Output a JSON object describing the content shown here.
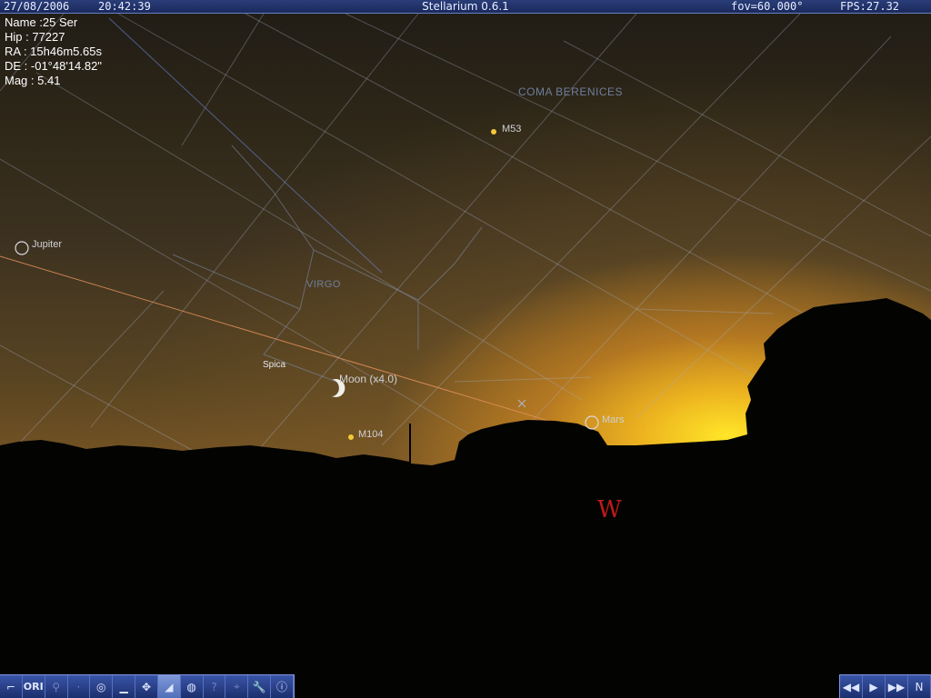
{
  "topbar": {
    "date": "27/08/2006",
    "time": "20:42:39",
    "title": "Stellarium 0.6.1",
    "fov": "fov=60.000°",
    "fps": "FPS:27.32"
  },
  "info": {
    "name": "Name :25 Ser",
    "hip": "Hip : 77227",
    "ra": "RA : 15h46m5.65s",
    "de": "DE : -01°48'14.82\"",
    "mag": "Mag : 5.41"
  },
  "sky_labels": {
    "jupiter": "Jupiter",
    "m53": "M53",
    "coma": "COMA BERENICES",
    "virgo": "VIRGO",
    "spica": "Spica",
    "moon": "Moon (x4.0)",
    "m104": "M104",
    "mars": "Mars",
    "west": "W"
  },
  "toolbar_left": [
    {
      "id": "constellation-lines",
      "icon": "constellation-icon",
      "label": "⌐",
      "state": "normal"
    },
    {
      "id": "constellation-names",
      "icon": "ori-icon",
      "label": "ORI",
      "state": "normal"
    },
    {
      "id": "constellation-art",
      "icon": "art-icon",
      "label": "⚲",
      "state": "dim"
    },
    {
      "id": "azimuth-grid",
      "icon": "dot-icon",
      "label": "·",
      "state": "dim"
    },
    {
      "id": "equatorial-grid",
      "icon": "grid-icon",
      "label": "◎",
      "state": "normal"
    },
    {
      "id": "ground",
      "icon": "ground-icon",
      "label": "▁",
      "state": "normal"
    },
    {
      "id": "cardinal-points",
      "icon": "cardinal-icon",
      "label": "✥",
      "state": "normal"
    },
    {
      "id": "atmosphere",
      "icon": "atmosphere-icon",
      "label": "◢",
      "state": "sel"
    },
    {
      "id": "nebulas",
      "icon": "nebula-icon",
      "label": "◍",
      "state": "normal"
    },
    {
      "id": "help",
      "icon": "help-icon",
      "label": "?",
      "state": "dim"
    },
    {
      "id": "equatorial-mount",
      "icon": "mount-icon",
      "label": "⌖",
      "state": "dim"
    },
    {
      "id": "configuration",
      "icon": "wrench-icon",
      "label": "🔧",
      "state": "normal"
    },
    {
      "id": "quit",
      "icon": "info-icon",
      "label": "ⓘ",
      "state": "normal"
    }
  ],
  "toolbar_right": [
    {
      "id": "rewind",
      "icon": "rewind-icon",
      "label": "◀◀",
      "state": "normal"
    },
    {
      "id": "play",
      "icon": "play-icon",
      "label": "▶",
      "state": "normal"
    },
    {
      "id": "fast-forward",
      "icon": "fast-forward-icon",
      "label": "▶▶",
      "state": "normal"
    },
    {
      "id": "now",
      "icon": "now-icon",
      "label": "N",
      "state": "normal"
    }
  ],
  "colors": {
    "grid": "#a7b3c9",
    "ecliptic": "#e0905a",
    "constellation": "#7f8faf",
    "star": "#f3c93a",
    "cardinal": "#c01a1a"
  }
}
